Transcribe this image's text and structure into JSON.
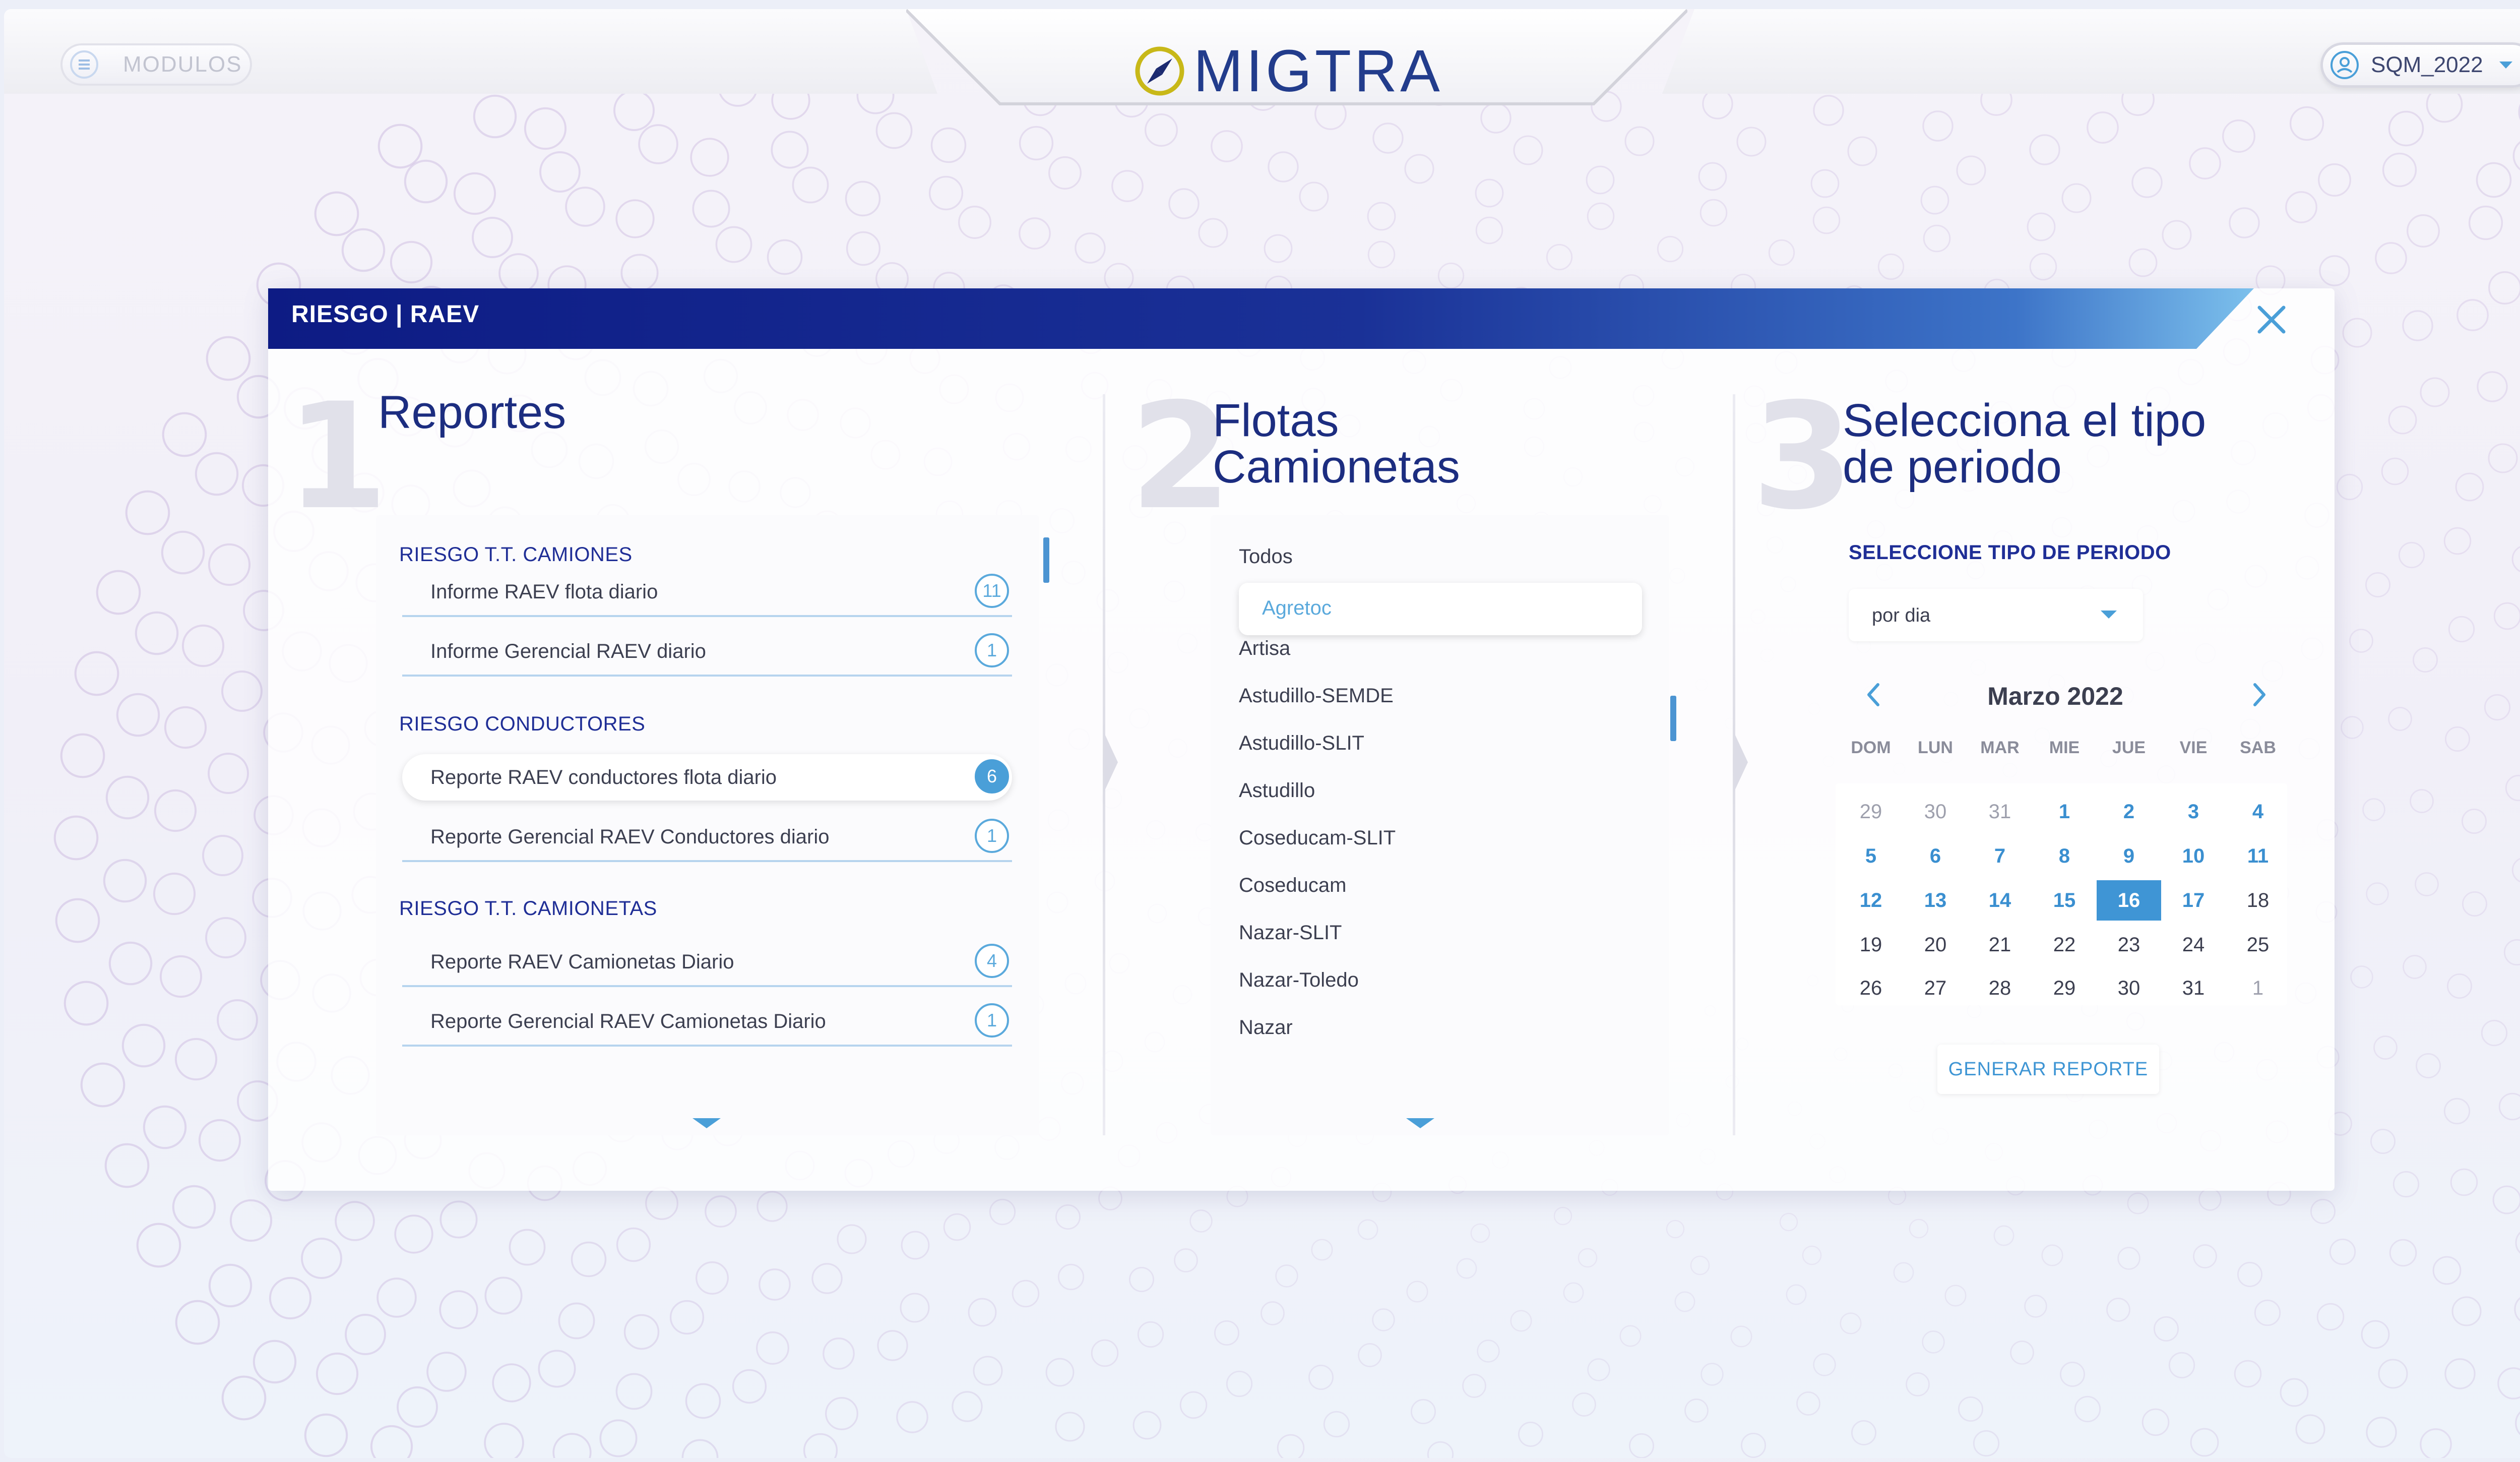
{
  "app": {
    "logo_text": "MIGTRA",
    "modules_label": "MODULOS",
    "user_label": "SQM_2022"
  },
  "modal": {
    "title": "RIESGO | RAEV"
  },
  "steps": [
    {
      "number": "1",
      "title": "Reportes"
    },
    {
      "number": "2",
      "title": "Flotas Camionetas"
    },
    {
      "number": "3",
      "title": "Selecciona el tipo de periodo"
    }
  ],
  "reports": {
    "sections": [
      {
        "label": "RIESGO T.T. CAMIONES",
        "items": [
          {
            "label": "Informe RAEV flota diario",
            "count": "11",
            "selected": false
          },
          {
            "label": "Informe Gerencial RAEV diario",
            "count": "1",
            "selected": false
          }
        ]
      },
      {
        "label": "RIESGO CONDUCTORES",
        "items": [
          {
            "label": "Reporte RAEV conductores flota diario",
            "count": "6",
            "selected": true
          },
          {
            "label": "Reporte Gerencial RAEV Conductores diario",
            "count": "1",
            "selected": false
          }
        ]
      },
      {
        "label": "RIESGO T.T. CAMIONETAS",
        "items": [
          {
            "label": "Reporte RAEV Camionetas Diario",
            "count": "4",
            "selected": false
          },
          {
            "label": "Reporte Gerencial RAEV Camionetas Diario",
            "count": "1",
            "selected": false
          }
        ]
      }
    ]
  },
  "fleets": {
    "items": [
      "Todos",
      "Agretoc",
      "Artisa",
      "Astudillo-SEMDE",
      "Astudillo-SLIT",
      "Astudillo",
      "Coseducam-SLIT",
      "Coseducam",
      "Nazar-SLIT",
      "Nazar-Toledo",
      "Nazar"
    ],
    "selected": "Agretoc"
  },
  "period": {
    "label": "SELECCIONE TIPO DE PERIODO",
    "value": "por dia",
    "calendar": {
      "month_label": "Marzo 2022",
      "weekdays": [
        "DOM",
        "LUN",
        "MAR",
        "MIE",
        "JUE",
        "VIE",
        "SAB"
      ],
      "weeks": [
        [
          "29",
          "30",
          "31",
          "1",
          "2",
          "3",
          "4"
        ],
        [
          "5",
          "6",
          "7",
          "8",
          "9",
          "10",
          "11"
        ],
        [
          "12",
          "13",
          "14",
          "15",
          "16",
          "17",
          "18"
        ],
        [
          "19",
          "20",
          "21",
          "22",
          "23",
          "24",
          "25"
        ],
        [
          "26",
          "27",
          "28",
          "29",
          "30",
          "31",
          "1"
        ]
      ],
      "selected_day": "16"
    },
    "generate_label": "GENERAR REPORTE"
  },
  "colors": {
    "accent": "#3f95d5",
    "header_dark": "#0d1b84",
    "title": "#1c2d80"
  }
}
